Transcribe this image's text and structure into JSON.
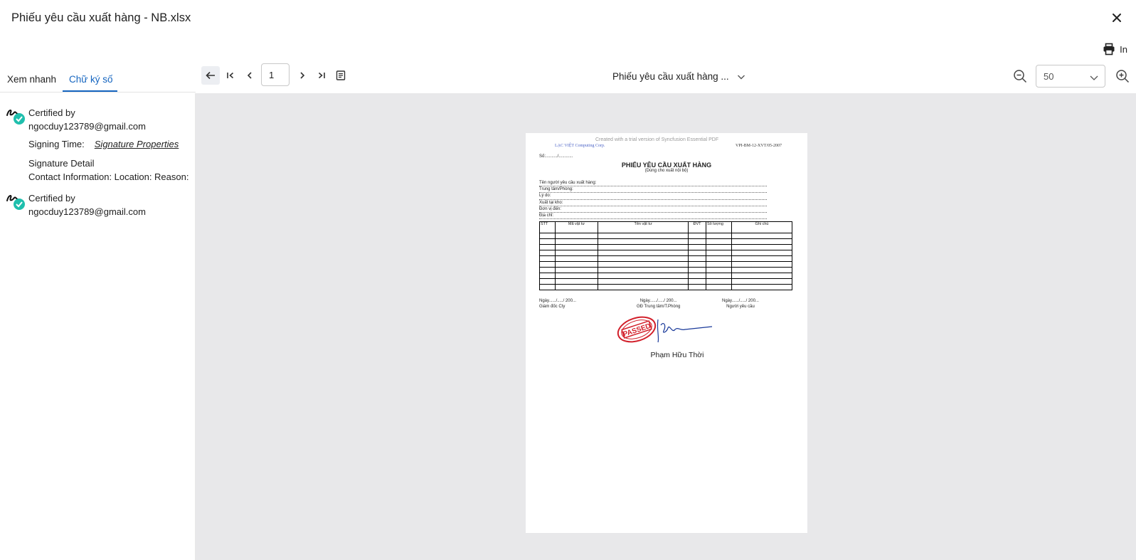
{
  "dialog": {
    "title": "Phiếu yêu cầu xuất hàng - NB.xlsx",
    "close_icon": "close-icon",
    "print_label": "In"
  },
  "tabs": [
    {
      "label": "Xem nhanh",
      "active": false
    },
    {
      "label": "Chữ ký số",
      "active": true
    }
  ],
  "signatures": [
    {
      "certified_label": "Certified by",
      "email": "ngocduy123789@gmail.com",
      "signing_time_label": "Signing Time:",
      "properties_link": "Signature Properties",
      "detail_label": "Signature Detail",
      "contact_line": "Contact Information: Location: Reason:"
    },
    {
      "certified_label": "Certified by",
      "email": "ngocduy123789@gmail.com"
    }
  ],
  "toolbar": {
    "page_number": "1",
    "document_name": "Phiếu yêu cầu xuất hàng ...",
    "zoom_value": "50"
  },
  "document": {
    "watermark": "Created with a trial version of Syncfusion Essential PDF",
    "company": "LẠC VIỆT Computing Corp.",
    "form_code": "VPI-BM-12-XVT/05-2007",
    "so_line": "Số:........../............",
    "heading": "PHIẾU YÊU CẦU XUẤT HÀNG",
    "subheading": "(Dùng cho xuất nội bộ)",
    "fields": [
      "Tên người yêu cầu xuất hàng:",
      "Trung tâm/Phòng:",
      "Lý do:",
      "Xuất tại kho:",
      "Đơn vị đến:",
      "Địa chỉ:"
    ],
    "table_headers": [
      "STT",
      "Mã vật tư",
      "Tên vật tư",
      "ĐVT",
      "Số lượng",
      "Ghi chú"
    ],
    "date_lines": [
      "Ngày....../...../ 200...",
      "Ngày....../...../ 200...",
      "Ngày....../...../ 200..."
    ],
    "signers": [
      "Giám đốc Cty",
      "GĐ Trung tâm/T.Phòng",
      "Người yêu cầu"
    ],
    "stamp_text": "PASSED",
    "signer_name": "Phạm Hữu Thời"
  },
  "colors": {
    "accent": "#1565c0",
    "verified": "#1fbfad",
    "stamp": "#d21f2a",
    "viewer_bg": "#e8e8ea"
  }
}
